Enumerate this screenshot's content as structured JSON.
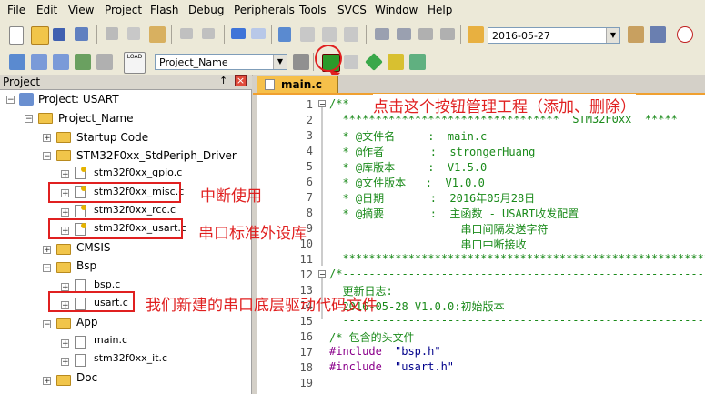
{
  "menu": [
    "File",
    "Edit",
    "View",
    "Project",
    "Flash",
    "Debug",
    "Peripherals",
    "Tools",
    "SVCS",
    "Window",
    "Help"
  ],
  "toolbar": {
    "date_value": "2016-05-27",
    "target_value": "Project_Name"
  },
  "project_panel": {
    "title": "Project",
    "pin": "↑",
    "close": "×",
    "root": "Project: USART",
    "target": "Project_Name",
    "groups": {
      "startup": "Startup Code",
      "stdperiph": "STM32F0xx_StdPeriph_Driver",
      "stdperiph_files": [
        "stm32f0xx_gpio.c",
        "stm32f0xx_misc.c",
        "stm32f0xx_rcc.c",
        "stm32f0xx_usart.c"
      ],
      "cmsis": "CMSIS",
      "bsp": "Bsp",
      "bsp_files": [
        "bsp.c",
        "usart.c"
      ],
      "app": "App",
      "app_files": [
        "main.c",
        "stm32f0xx_it.c"
      ],
      "doc": "Doc"
    }
  },
  "annotations": {
    "manage_button": "点击这个按钮管理工程（添加、删除）",
    "interrupt": "中断使用",
    "serial_lib": "串口标准外设库",
    "new_driver": "我们新建的串口底层驱动代码文件"
  },
  "editor": {
    "tab": "main.c",
    "line_numbers": [
      "1",
      "2",
      "3",
      "4",
      "5",
      "6",
      "7",
      "8",
      "9",
      "10",
      "11",
      "12",
      "13",
      "14",
      "15",
      "16",
      "17",
      "18",
      "19"
    ],
    "lines": {
      "l1": "/**",
      "l2": "  *********************************  STM32F0xx  *****",
      "l3": "  * @文件名     :  main.c",
      "l4": "  * @作者       :  strongerHuang",
      "l5": "  * @库版本     :  V1.5.0",
      "l6": "  * @文件版本   :  V1.0.0",
      "l7": "  * @日期       :  2016年05月28日",
      "l8": "  * @摘要       :  主函数 - USART收发配置",
      "l9": "                    串口间隔发送字符",
      "l10": "                    串口中断接收",
      "l11": "  ***********************************************************",
      "l12": "/*-----------------------------------------------------------",
      "l13": "  更新日志:",
      "l14": "  2016-05-28 V1.0.0:初始版本",
      "l15": "  -----------------------------------------------------------",
      "l16": "/* 包含的头文件 ---------------------------------------------",
      "l17_kw": "#include",
      "l17_str": "\"bsp.h\"",
      "l18_kw": "#include",
      "l18_str": "\"usart.h\""
    }
  }
}
